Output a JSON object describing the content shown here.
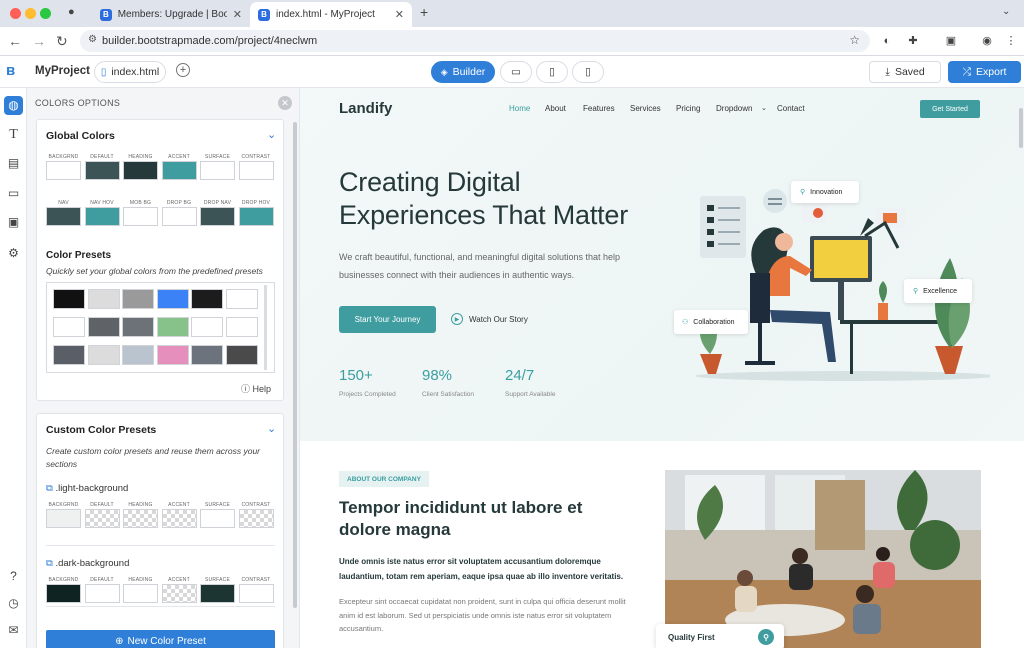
{
  "browser": {
    "tabs": [
      {
        "label": "Members: Upgrade | Bootstra",
        "active": false
      },
      {
        "label": "index.html - MyProject",
        "active": true
      }
    ],
    "url": "builder.bootstrapmade.com/project/4neclwm"
  },
  "app": {
    "project_name": "MyProject",
    "file_tab": "index.html",
    "builder_label": "Builder",
    "saved_label": "Saved",
    "export_label": "Export"
  },
  "panel": {
    "title": "COLORS OPTIONS",
    "global": {
      "title": "Global Colors",
      "row1": [
        {
          "label": "BACKGRND",
          "color": "#ffffff"
        },
        {
          "label": "DEFAULT",
          "color": "#3d5456"
        },
        {
          "label": "HEADING",
          "color": "#26393a"
        },
        {
          "label": "ACCENT",
          "color": "#3f9da0"
        },
        {
          "label": "SURFACE",
          "color": "#ffffff"
        },
        {
          "label": "CONTRAST",
          "color": "#ffffff"
        }
      ],
      "row2": [
        {
          "label": "NAV",
          "color": "#3d5456"
        },
        {
          "label": "NAV HOV",
          "color": "#3f9da0"
        },
        {
          "label": "MOB BG",
          "color": "#ffffff"
        },
        {
          "label": "DROP BG",
          "color": "#ffffff"
        },
        {
          "label": "DROP NAV",
          "color": "#3d5456"
        },
        {
          "label": "DROP HOV",
          "color": "#3f9da0"
        }
      ]
    },
    "presets": {
      "title": "Color Presets",
      "subtitle": "Quickly set your global colors from the predefined presets",
      "swatches": [
        "#111111",
        "#dcdcdc",
        "#9a9a9a",
        "#3b82f6",
        "#1c1c1c",
        "#ffffff",
        "#ffffff",
        "#5f6367",
        "#6d7278",
        "#86c28a",
        "#ffffff",
        "#ffffff",
        "#5a5e66",
        "#dcdcdc",
        "#b9c4cf",
        "#e58fbd",
        "#6c737c",
        "#4a4a4a"
      ],
      "help": "Help"
    },
    "custom": {
      "title": "Custom Color Presets",
      "desc": "Create custom color presets and reuse them across your sections",
      "sets": [
        {
          "name": ".light-background",
          "swatches": [
            {
              "label": "BACKGRND",
              "color": "#eef1f0"
            },
            {
              "label": "DEFAULT",
              "color": "checker"
            },
            {
              "label": "HEADING",
              "color": "checker"
            },
            {
              "label": "ACCENT",
              "color": "checker"
            },
            {
              "label": "SURFACE",
              "color": "#ffffff"
            },
            {
              "label": "CONTRAST",
              "color": "checker"
            }
          ]
        },
        {
          "name": ".dark-background",
          "swatches": [
            {
              "label": "BACKGRND",
              "color": "#0f2422"
            },
            {
              "label": "DEFAULT",
              "color": "#ffffff"
            },
            {
              "label": "HEADING",
              "color": "#ffffff"
            },
            {
              "label": "ACCENT",
              "color": "checker"
            },
            {
              "label": "SURFACE",
              "color": "#1c3533"
            },
            {
              "label": "CONTRAST",
              "color": "#ffffff"
            }
          ]
        }
      ],
      "new_button": "New Color Preset"
    }
  },
  "site": {
    "logo": "Landify",
    "nav": [
      "Home",
      "About",
      "Features",
      "Services",
      "Pricing",
      "Dropdown",
      "Contact"
    ],
    "cta": "Get Started",
    "hero_title_1": "Creating Digital",
    "hero_title_2": "Experiences That Matter",
    "hero_text": "We craft beautiful, functional, and meaningful digital solutions that help businesses connect with their audiences in authentic ways.",
    "primary_btn": "Start Your Journey",
    "secondary_btn": "Watch Our Story",
    "stats": [
      {
        "value": "150+",
        "label": "Projects Completed"
      },
      {
        "value": "98%",
        "label": "Client Satisfaction"
      },
      {
        "value": "24/7",
        "label": "Support Available"
      }
    ],
    "badges": [
      "Innovation",
      "Excellence",
      "Collaboration"
    ],
    "about": {
      "tag": "ABOUT OUR COMPANY",
      "title_1": "Tempor incididunt ut labore et",
      "title_2": "dolore magna",
      "lead": "Unde omnis iste natus error sit voluptatem accusantium doloremque laudantium, totam rem aperiam, eaque ipsa quae ab illo inventore veritatis.",
      "body": "Excepteur sint occaecat cupidatat non proident, sunt in culpa qui officia deserunt mollit anim id est laborum. Sed ut perspiciatis unde omnis iste natus error sit voluptatem accusantium.",
      "quality": "Quality First"
    }
  },
  "colors": {
    "accent": "#3f9da0",
    "brand_blue": "#2f7fd8"
  }
}
